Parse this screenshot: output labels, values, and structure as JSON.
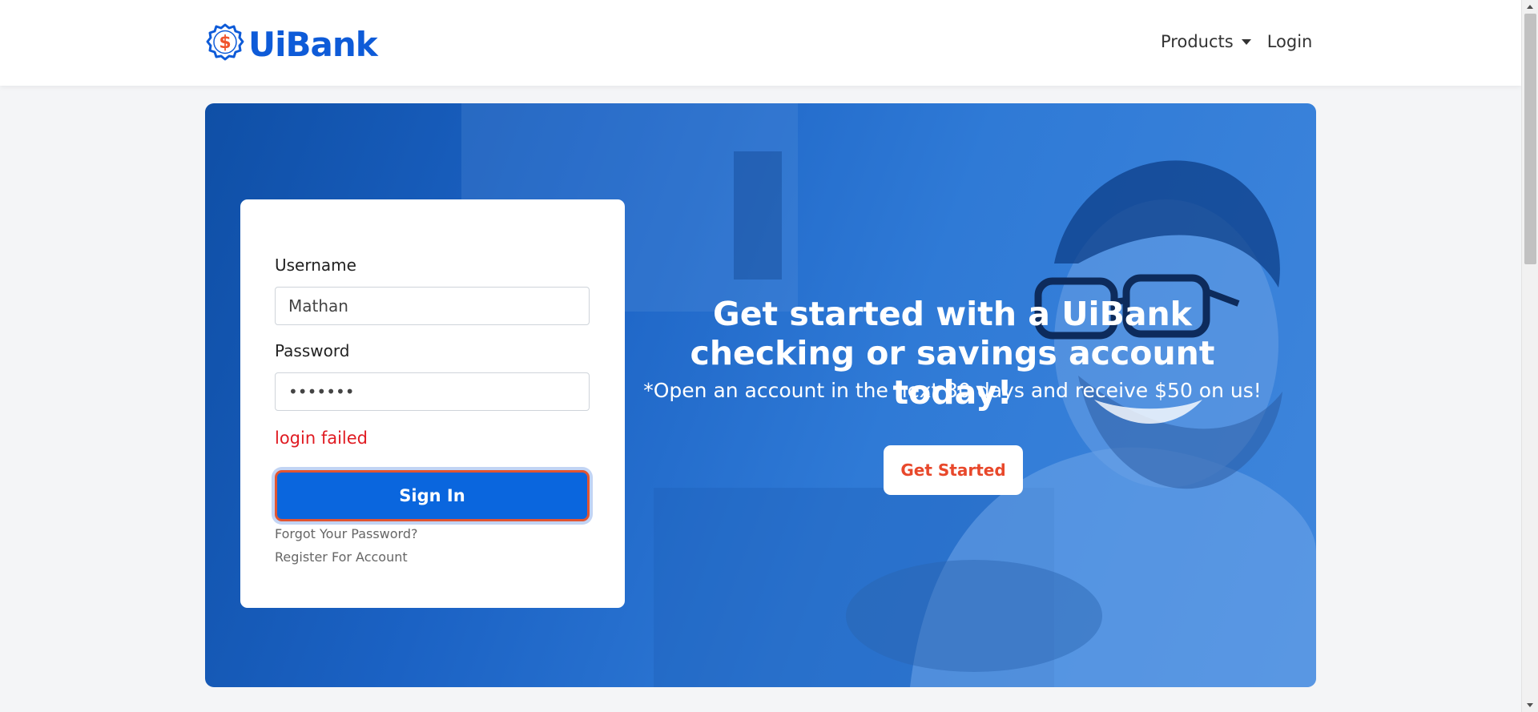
{
  "brand": {
    "name": "UiBank",
    "symbol": "$"
  },
  "nav": {
    "products_label": "Products",
    "login_label": "Login"
  },
  "login": {
    "username_label": "Username",
    "username_value": "Mathan",
    "password_label": "Password",
    "password_value": "•••••••",
    "error": "login failed",
    "signin_label": "Sign In",
    "forgot_label": "Forgot Your Password?",
    "register_label": "Register For Account"
  },
  "hero": {
    "heading": "Get started with a UiBank checking or savings account today!",
    "subheading": "*Open an account in the next 30 days and receive $50 on us!",
    "cta_label": "Get Started"
  },
  "colors": {
    "brand_blue": "#0e5bd8",
    "accent_orange": "#e8482b",
    "error_red": "#e01b22",
    "button_blue": "#0a66de"
  }
}
